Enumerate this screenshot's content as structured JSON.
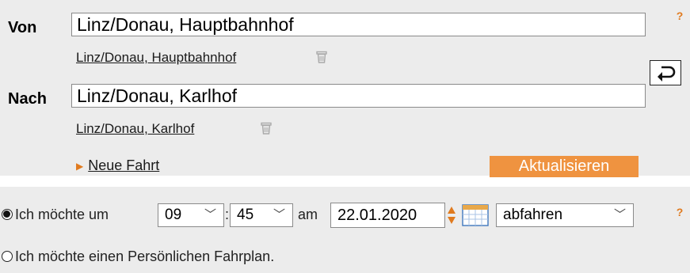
{
  "from": {
    "label": "Von",
    "value": "Linz/Donau, Hauptbahnhof",
    "suggestion": "Linz/Donau, Hauptbahnhof"
  },
  "to": {
    "label": "Nach",
    "value": "Linz/Donau, Karlhof",
    "suggestion": "Linz/Donau, Karlhof"
  },
  "help_mark": "?",
  "swap_icon": "swap-arrow-icon",
  "new_trip_label": "Neue Fahrt",
  "update_button": "Aktualisieren",
  "time_option": {
    "prefix": "Ich möchte um",
    "hour": "09",
    "minute": "45",
    "am_label": "am",
    "date": "22.01.2020",
    "mode": "abfahren",
    "selected": true
  },
  "personal_option": {
    "label": "Ich möchte einen Persönlichen Fahrplan.",
    "selected": false
  },
  "colors": {
    "accent": "#ef9340",
    "help": "#e07a1e",
    "panel": "#ececec"
  }
}
